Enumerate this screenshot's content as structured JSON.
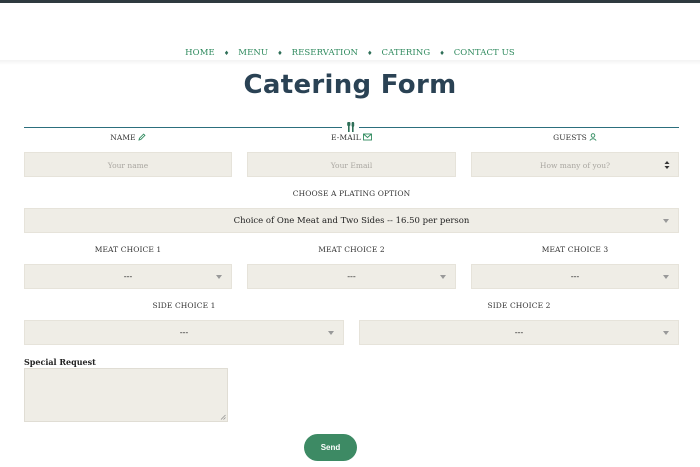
{
  "nav": {
    "items": [
      "HOME",
      "MENU",
      "RESERVATION",
      "CATERING",
      "CONTACT US"
    ],
    "separator": "♦"
  },
  "page": {
    "title": "Catering Form"
  },
  "form": {
    "name": {
      "label": "NAME",
      "placeholder": "Your name",
      "icon": "pencil-icon"
    },
    "email": {
      "label": "E-MAIL",
      "placeholder": "Your Email",
      "icon": "envelope-icon"
    },
    "guests": {
      "label": "GUESTS",
      "placeholder": "How many of you?",
      "icon": "person-icon"
    },
    "plating": {
      "label": "CHOOSE A PLATING OPTION",
      "value": "Choice of One Meat and Two Sides -- 16.50 per person"
    },
    "meat1": {
      "label": "MEAT CHOICE 1",
      "value": "---"
    },
    "meat2": {
      "label": "MEAT CHOICE 2",
      "value": "---"
    },
    "meat3": {
      "label": "MEAT CHOICE 3",
      "value": "---"
    },
    "side1": {
      "label": "SIDE CHOICE 1",
      "value": "---"
    },
    "side2": {
      "label": "SIDE CHOICE 2",
      "value": "---"
    },
    "special": {
      "label": "Special Request",
      "value": ""
    },
    "send_label": "Send"
  },
  "colors": {
    "accent": "#3d8a64",
    "nav_link": "#2f8a5e",
    "title": "#2a4254",
    "field_bg": "#efede6",
    "rule": "#2c6f7d"
  },
  "icons": {
    "divider": "cutlery-icon"
  }
}
